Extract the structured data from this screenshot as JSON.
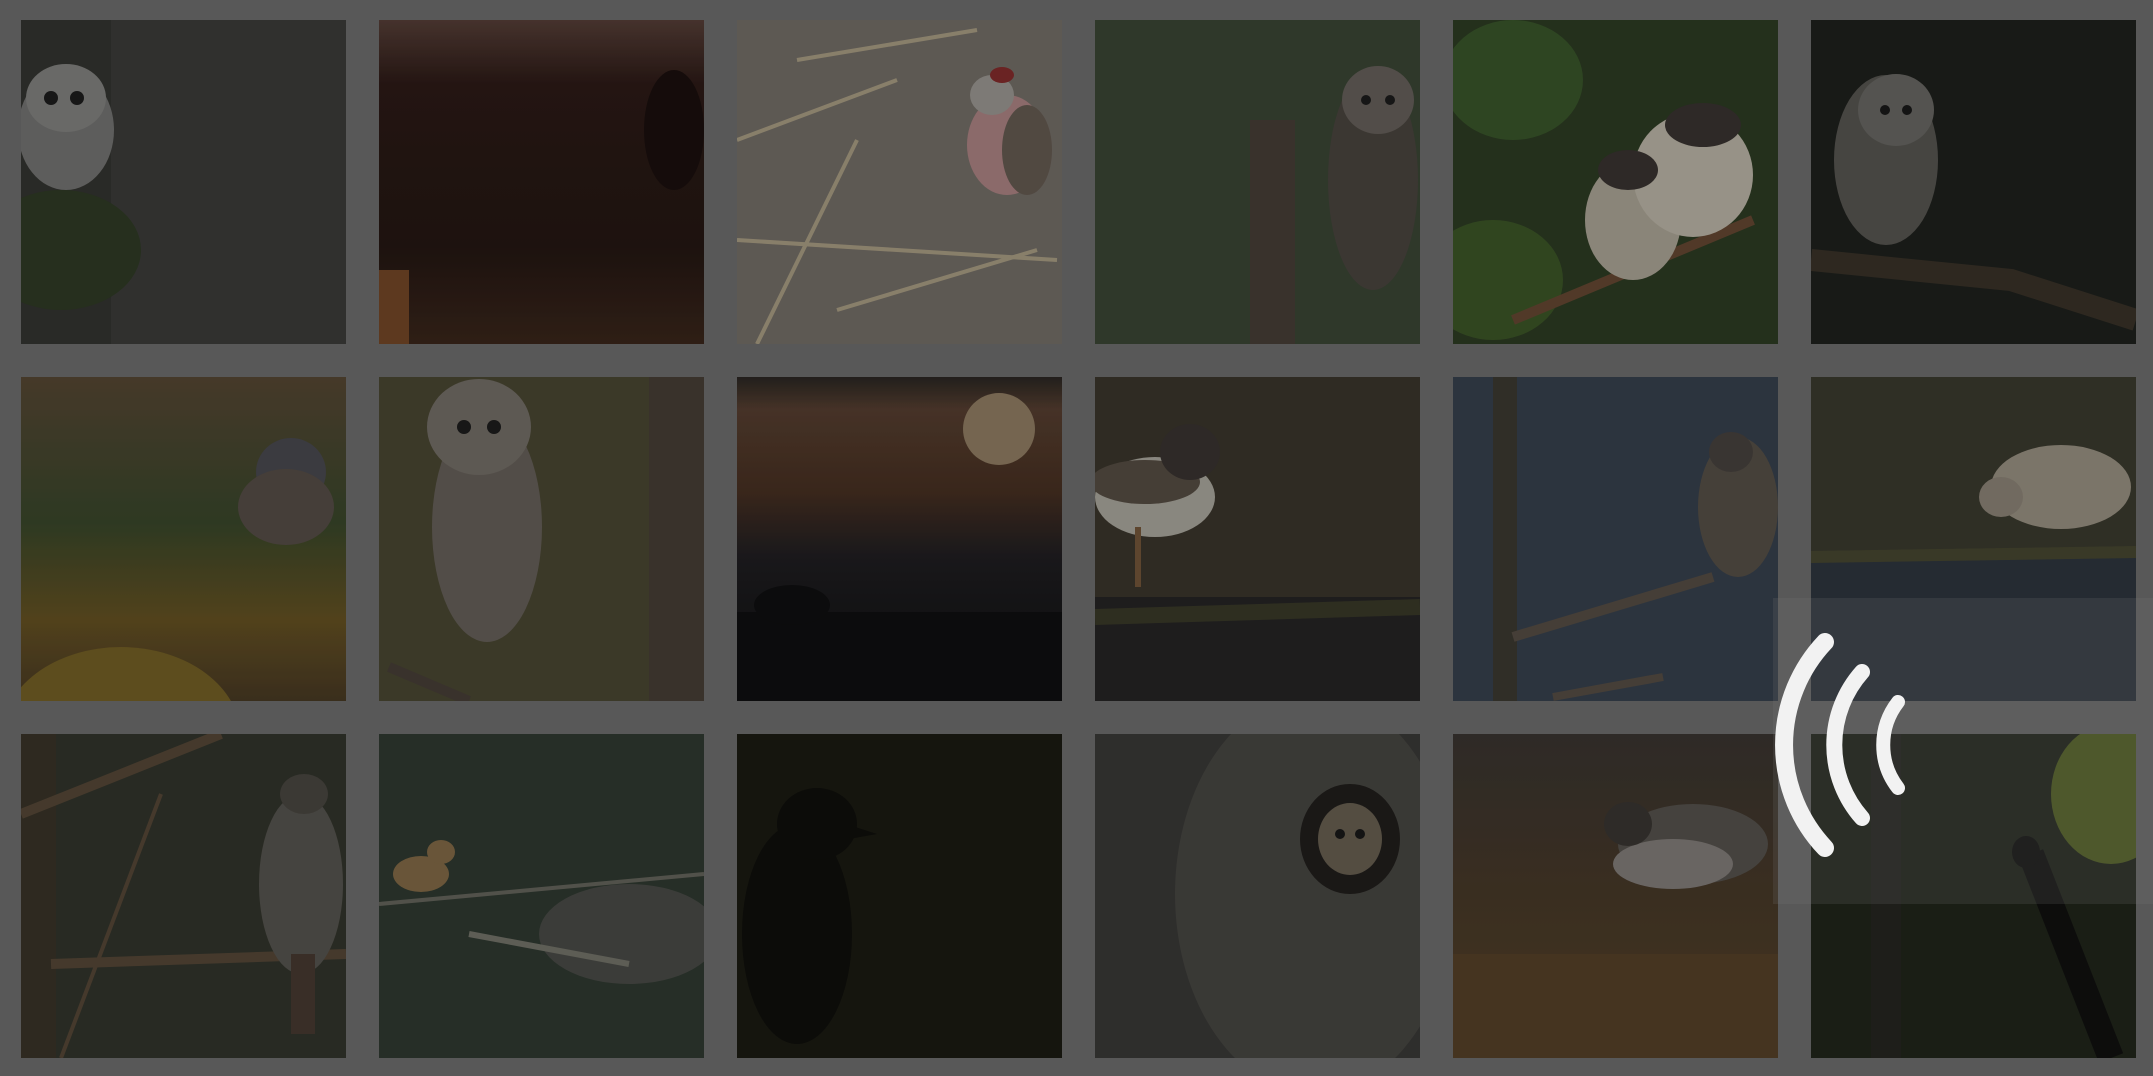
{
  "gallery": {
    "tiles": [
      {
        "subject": "owlet",
        "bg": "#3b3b38"
      },
      {
        "subject": "sunset-dark",
        "bg": "#2a1a16"
      },
      {
        "subject": "redpoll",
        "bg": "#7d776f"
      },
      {
        "subject": "barred-owl-stump",
        "bg": "#3a4633"
      },
      {
        "subject": "swallows",
        "bg": "#2d3d23"
      },
      {
        "subject": "barred-owl-dark",
        "bg": "#1c1d1a"
      },
      {
        "subject": "junco",
        "bg": "#54503a"
      },
      {
        "subject": "barred-owl-perch",
        "bg": "#4d4a32"
      },
      {
        "subject": "moon-silhouette",
        "bg": "#2b2520"
      },
      {
        "subject": "plover",
        "bg": "#3a352a"
      },
      {
        "subject": "falcon",
        "bg": "#38414a"
      },
      {
        "subject": "knot",
        "bg": "#3b3a2e"
      },
      {
        "subject": "hawk",
        "bg": "#33352b"
      },
      {
        "subject": "waxwing",
        "bg": "#2f3a30"
      },
      {
        "subject": "crow-silhouette",
        "bg": "#16160f"
      },
      {
        "subject": "owl-in-cavity",
        "bg": "#3a3a38"
      },
      {
        "subject": "plover-grass",
        "bg": "#3d3227"
      },
      {
        "subject": "perched-bird-dark",
        "bg": "#1f2419"
      }
    ]
  },
  "overlay": {
    "icon": "wireless-signal-icon",
    "icon_color": "#f2f2f2"
  }
}
